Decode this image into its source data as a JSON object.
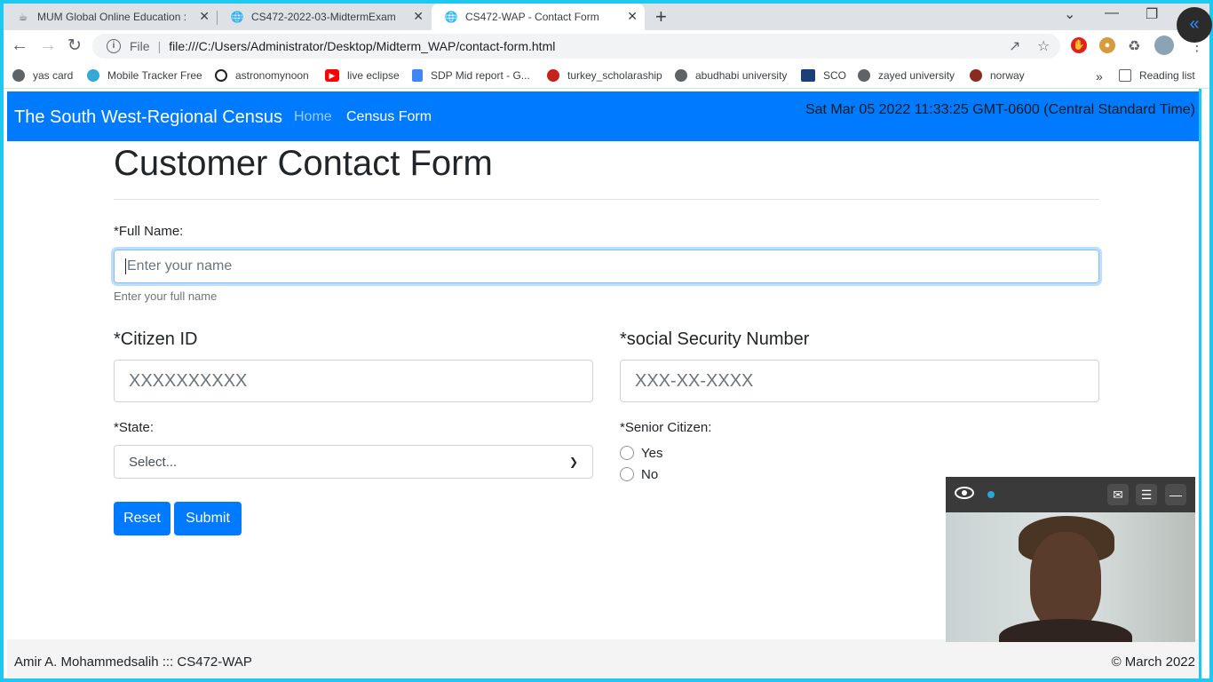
{
  "browser": {
    "tabs": [
      {
        "title": "MUM Global Online Education : C",
        "icon": "mum-icon"
      },
      {
        "title": "CS472-2022-03-MidtermExam",
        "icon": "globe-icon"
      },
      {
        "title": "CS472-WAP - Contact Form",
        "icon": "globe-icon"
      }
    ],
    "address": {
      "label": "File",
      "url": "file:///C:/Users/Administrator/Desktop/Midterm_WAP/contact-form.html"
    },
    "bookmarks": [
      {
        "label": "yas card",
        "color": "#5f6368"
      },
      {
        "label": "Mobile Tracker Free",
        "color": "#35a8d6"
      },
      {
        "label": "astronomynoon",
        "color": "#202124"
      },
      {
        "label": "live eclipse",
        "color": "#ff0000"
      },
      {
        "label": "SDP Mid report - G...",
        "color": "#4285f4"
      },
      {
        "label": "turkey_scholaraship",
        "color": "#c5221f"
      },
      {
        "label": "abudhabi university",
        "color": "#5f6368"
      },
      {
        "label": "SCO",
        "color": "#1b3f7a"
      },
      {
        "label": "zayed university",
        "color": "#5f6368"
      },
      {
        "label": "norway",
        "color": "#8b2a1e"
      }
    ],
    "reading_list": "Reading list"
  },
  "navbar": {
    "brand": "The South West-Regional Census",
    "home": "Home",
    "census_form": "Census Form",
    "datetime": "Sat Mar 05 2022 11:33:25 GMT-0600 (Central Standard Time)"
  },
  "form": {
    "heading": "Customer Contact Form",
    "full_name_label": "*Full Name:",
    "full_name_placeholder": "Enter your name",
    "full_name_help": "Enter your full name",
    "citizen_id_label": "*Citizen ID",
    "citizen_id_placeholder": "XXXXXXXXXX",
    "ssn_label": "*social Security Number",
    "ssn_placeholder": "XXX-XX-XXXX",
    "state_label": "*State:",
    "state_selected": "Select...",
    "senior_label": "*Senior Citizen:",
    "senior_yes": "Yes",
    "senior_no": "No",
    "reset": "Reset",
    "submit": "Submit"
  },
  "footer": {
    "author": "Amir A. Mohammedsalih ::: CS472-WAP",
    "copyright": "© March 2022"
  },
  "colors": {
    "primary": "#007bff",
    "frame": "#1ec8f0"
  }
}
